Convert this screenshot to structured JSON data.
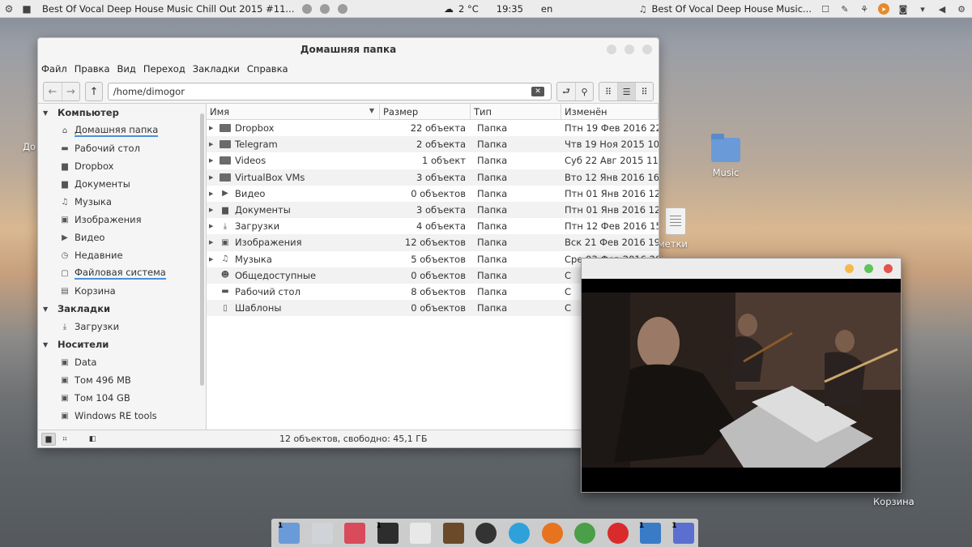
{
  "top_panel": {
    "active_title": "Best Of Vocal Deep House Music Chill Out 2015 #11...",
    "weather": "2 °C",
    "time": "19:35",
    "lang": "en",
    "right_title": "Best Of Vocal Deep House Music..."
  },
  "desktop": {
    "left_partial_label": "До",
    "music_label": "Music",
    "notes_partial_label": "метки",
    "trash_label": "Корзина"
  },
  "file_manager": {
    "title": "Домашняя папка",
    "menu": [
      "Файл",
      "Правка",
      "Вид",
      "Переход",
      "Закладки",
      "Справка"
    ],
    "path": "/home/dimogor",
    "sidebar": {
      "computer_section": "Компьютер",
      "computer_items": [
        {
          "icon": "home-icon",
          "label": "Домашняя папка"
        },
        {
          "icon": "desktop-icon",
          "label": "Рабочий стол"
        },
        {
          "icon": "folder-icon",
          "label": "Dropbox"
        },
        {
          "icon": "documents-icon",
          "label": "Документы"
        },
        {
          "icon": "music-icon",
          "label": "Музыка"
        },
        {
          "icon": "image-icon",
          "label": "Изображения"
        },
        {
          "icon": "video-icon",
          "label": "Видео"
        },
        {
          "icon": "recent-icon",
          "label": "Недавние"
        },
        {
          "icon": "filesystem-icon",
          "label": "Файловая система"
        },
        {
          "icon": "trash-icon",
          "label": "Корзина"
        }
      ],
      "bookmarks_section": "Закладки",
      "bookmarks_items": [
        {
          "icon": "download-icon",
          "label": "Загрузки"
        }
      ],
      "devices_section": "Носители",
      "devices_items": [
        {
          "icon": "drive-icon",
          "label": "Data"
        },
        {
          "icon": "drive-icon",
          "label": "Том 496 MB"
        },
        {
          "icon": "drive-icon",
          "label": "Том 104 GB"
        },
        {
          "icon": "drive-icon",
          "label": "Windows RE tools"
        }
      ]
    },
    "columns": {
      "name": "Имя",
      "size": "Размер",
      "type": "Тип",
      "modified": "Изменён"
    },
    "files": [
      {
        "name": "Dropbox",
        "icon": "folder-icon",
        "size": "22 объекта",
        "type": "Папка",
        "modified": "Птн 19 Фев 2016 22:"
      },
      {
        "name": "Telegram",
        "icon": "folder-icon",
        "size": "2 объекта",
        "type": "Папка",
        "modified": "Чтв 19 Ноя 2015 10:1"
      },
      {
        "name": "Videos",
        "icon": "folder-icon",
        "size": "1 объект",
        "type": "Папка",
        "modified": "Суб 22 Авг 2015 11:0"
      },
      {
        "name": "VirtualBox VMs",
        "icon": "folder-icon",
        "size": "3 объекта",
        "type": "Папка",
        "modified": "Вто 12 Янв 2016 16:3"
      },
      {
        "name": "Видео",
        "icon": "video-icon",
        "size": "0 объектов",
        "type": "Папка",
        "modified": "Птн 01 Янв 2016 12:"
      },
      {
        "name": "Документы",
        "icon": "documents-icon",
        "size": "3 объекта",
        "type": "Папка",
        "modified": "Птн 01 Янв 2016 12:"
      },
      {
        "name": "Загрузки",
        "icon": "download-icon",
        "size": "4 объекта",
        "type": "Папка",
        "modified": "Птн 12 Фев 2016 15:"
      },
      {
        "name": "Изображения",
        "icon": "image-icon",
        "size": "12 объектов",
        "type": "Папка",
        "modified": "Вск 21 Фев 2016 19:2"
      },
      {
        "name": "Музыка",
        "icon": "music-icon",
        "size": "5 объектов",
        "type": "Папка",
        "modified": "Сре 03 Фев 2016 20:"
      },
      {
        "name": "Общедоступные",
        "icon": "public-icon",
        "size": "0 объектов",
        "type": "Папка",
        "modified": "С"
      },
      {
        "name": "Рабочий стол",
        "icon": "desktop-icon",
        "size": "8 объектов",
        "type": "Папка",
        "modified": "С"
      },
      {
        "name": "Шаблоны",
        "icon": "template-icon",
        "size": "0 объектов",
        "type": "Папка",
        "modified": "С"
      }
    ],
    "status": "12 объектов, свободно: 45,1 ГБ"
  },
  "player": {
    "ctrl_colors": [
      "#f5b94a",
      "#5fc35a",
      "#e5534b"
    ]
  },
  "dock": {
    "items": [
      {
        "icon": "file-manager-icon",
        "badge": "1",
        "color": "#6a9bd8"
      },
      {
        "icon": "downloader-icon",
        "badge": "",
        "color": "#d0d4d8"
      },
      {
        "icon": "music-player-icon",
        "badge": "",
        "color": "#d94a5a"
      },
      {
        "icon": "terminal-icon",
        "badge": "1",
        "color": "#2d2d2d"
      },
      {
        "icon": "text-editor-icon",
        "badge": "",
        "color": "#e8e8e8"
      },
      {
        "icon": "inkscape-icon",
        "badge": "",
        "color": "#6b4a2a"
      },
      {
        "icon": "amazon-icon",
        "badge": "",
        "color": "#333333"
      },
      {
        "icon": "telegram-icon",
        "badge": "",
        "color": "#2ea1db"
      },
      {
        "icon": "firefox-icon",
        "badge": "",
        "color": "#e8731f"
      },
      {
        "icon": "chrome-icon",
        "badge": "",
        "color": "#4a9f48"
      },
      {
        "icon": "yandex-browser-icon",
        "badge": "",
        "color": "#d92b2b"
      },
      {
        "icon": "system-monitor-icon",
        "badge": "1",
        "color": "#3a7bc8"
      },
      {
        "icon": "video-player-icon",
        "badge": "1",
        "color": "#5a6fd0"
      }
    ]
  }
}
